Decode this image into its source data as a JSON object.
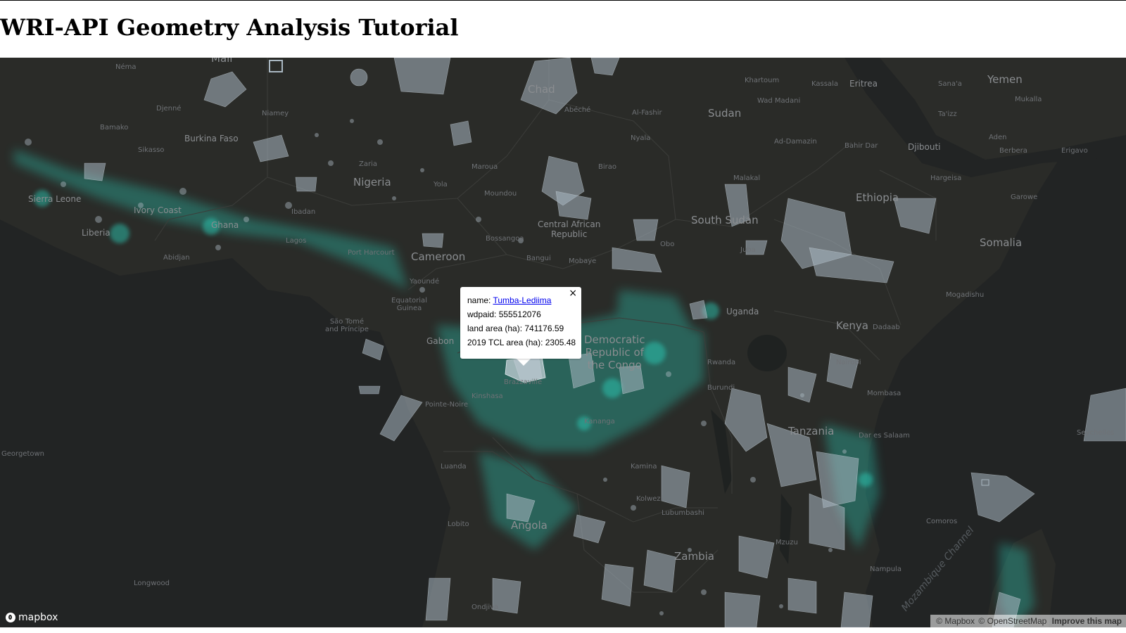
{
  "page": {
    "title": "WRI-API Geometry Analysis Tutorial"
  },
  "map": {
    "colors": {
      "land": "#2a2b28",
      "water": "#222424",
      "forest": "#2bd6c0",
      "protected_area": "#aab8c2"
    },
    "labels": {
      "mali": "Mali",
      "niamey": "Niamey",
      "bamako": "Bamako",
      "djenne": "Djenné",
      "burkina_faso": "Burkina Faso",
      "sikasso": "Sikasso",
      "chad": "Chad",
      "abeche": "Abéché",
      "al_fashir": "Al-Fashir",
      "khartoum": "Khartoum",
      "kassala": "Kassala",
      "eritrea": "Eritrea",
      "wad_madani": "Wad Madani",
      "sudan": "Sudan",
      "yemen": "Yemen",
      "sanaa": "Sana'a",
      "mukalla": "Mukalla",
      "taizz": "Ta'izz",
      "aden": "Aden",
      "djibouti": "Djibouti",
      "bahir_dar": "Bahir Dar",
      "ad_damazin": "Ad-Damazin",
      "nyala": "Nyala",
      "berbera": "Berbera",
      "erigavo": "Erigavo",
      "hargeisa": "Hargeisa",
      "ethiopia": "Ethiopia",
      "garowe": "Garowe",
      "nigeria": "Nigeria",
      "zaria": "Zaria",
      "yola": "Yola",
      "maroua": "Maroua",
      "moundou": "Moundou",
      "birao": "Birao",
      "malakal": "Malakal",
      "south_sudan": "South Sudan",
      "somalia": "Somalia",
      "ghana": "Ghana",
      "ivory_coast": "Ivory Coast",
      "sierra_leone": "Sierra Leone",
      "liberia": "Liberia",
      "abidjan": "Abidjan",
      "lagos": "Lagos",
      "ibadan": "Ibadan",
      "port_harcourt": "Port Harcourt",
      "cameroon": "Cameroon",
      "bossangoa": "Bossangoa",
      "bangui": "Bangui",
      "central_african_republic": "Central African\nRepublic",
      "mobaye": "Mobaye",
      "obo": "Obo",
      "juba": "Juba",
      "yaounde": "Yaoundé",
      "equatorial_guinea": "Equatorial\nGuinea",
      "sao_tome": "São Tomé\nand Príncipe",
      "gabon": "Gabon",
      "uganda": "Uganda",
      "kenya": "Kenya",
      "dadaab": "Dadaab",
      "mogadishu": "Mogadishu",
      "drc": "Democratic\nRepublic of\nthe Congo",
      "rwanda": "Rwanda",
      "burundi": "Burundi",
      "nairobi": "Nairobi",
      "mombasa": "Mombasa",
      "kinshasa": "Kinshasa",
      "brazzaville": "Brazzaville",
      "pointe_noire": "Pointe-Noire",
      "luanda": "Luanda",
      "tanzania": "Tanzania",
      "dar_es_salaam": "Dar es Salaam",
      "seychelles": "Seychelles",
      "kananga": "Kananga",
      "kamina": "Kamina",
      "kolwezi": "Kolwezi",
      "lubumbashi": "Lubumbashi",
      "angola": "Angola",
      "lobito": "Lobito",
      "zambia": "Zambia",
      "comoros": "Comoros",
      "nampula": "Nampula",
      "mozambique_channel": "Mozambique Channel",
      "georgetown": "Georgetown",
      "longwood": "Longwood",
      "ondjiva": "Ondjiva",
      "mzuzu": "Mzuzu"
    }
  },
  "popup": {
    "name_label": "name: ",
    "name_value": "Tumba-Lediima",
    "wdpaid": "wdpaid: 555512076",
    "land_area": "land area (ha): 741176.59",
    "tcl_area": "2019 TCL area (ha): 2305.48",
    "close": "×"
  },
  "footer": {
    "logo": "mapbox",
    "attribution_mapbox": "© Mapbox",
    "attribution_osm": "© OpenStreetMap",
    "improve": "Improve this map"
  }
}
